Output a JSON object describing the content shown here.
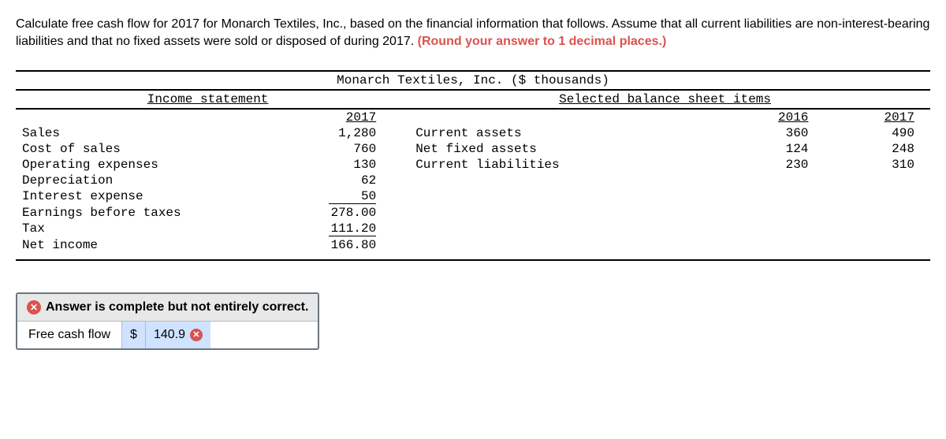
{
  "question": {
    "text_part1": "Calculate free cash flow for 2017 for Monarch Textiles, Inc., based on the financial information that follows. Assume that all current liabilities are non-interest-bearing liabilities and that no fixed assets were sold or disposed of during 2017. ",
    "text_part2": "(Round your answer to 1 decimal places.)"
  },
  "table": {
    "title": "Monarch Textiles, Inc. ($ thousands)",
    "income_header": "Income statement",
    "balance_header": "Selected balance sheet items",
    "year_2017": "2017",
    "year_2016": "2016",
    "income_statement": [
      {
        "label": "Sales",
        "value": "1,280"
      },
      {
        "label": "Cost of sales",
        "value": "760"
      },
      {
        "label": "Operating expenses",
        "value": "130"
      },
      {
        "label": "Depreciation",
        "value": "62"
      },
      {
        "label": "Interest expense",
        "value": "50"
      },
      {
        "label": "Earnings before taxes",
        "value": "278.00"
      },
      {
        "label": "Tax",
        "value": "111.20"
      },
      {
        "label": "Net income",
        "value": "166.80"
      }
    ],
    "balance_sheet": [
      {
        "label": "Current assets",
        "v2016": "360",
        "v2017": "490"
      },
      {
        "label": "Net fixed assets",
        "v2016": "124",
        "v2017": "248"
      },
      {
        "label": "Current liabilities",
        "v2016": "230",
        "v2017": "310"
      }
    ]
  },
  "feedback": {
    "header_text": "Answer is complete but not entirely correct.",
    "answer_label": "Free cash flow",
    "currency": "$",
    "value": "140.9"
  }
}
